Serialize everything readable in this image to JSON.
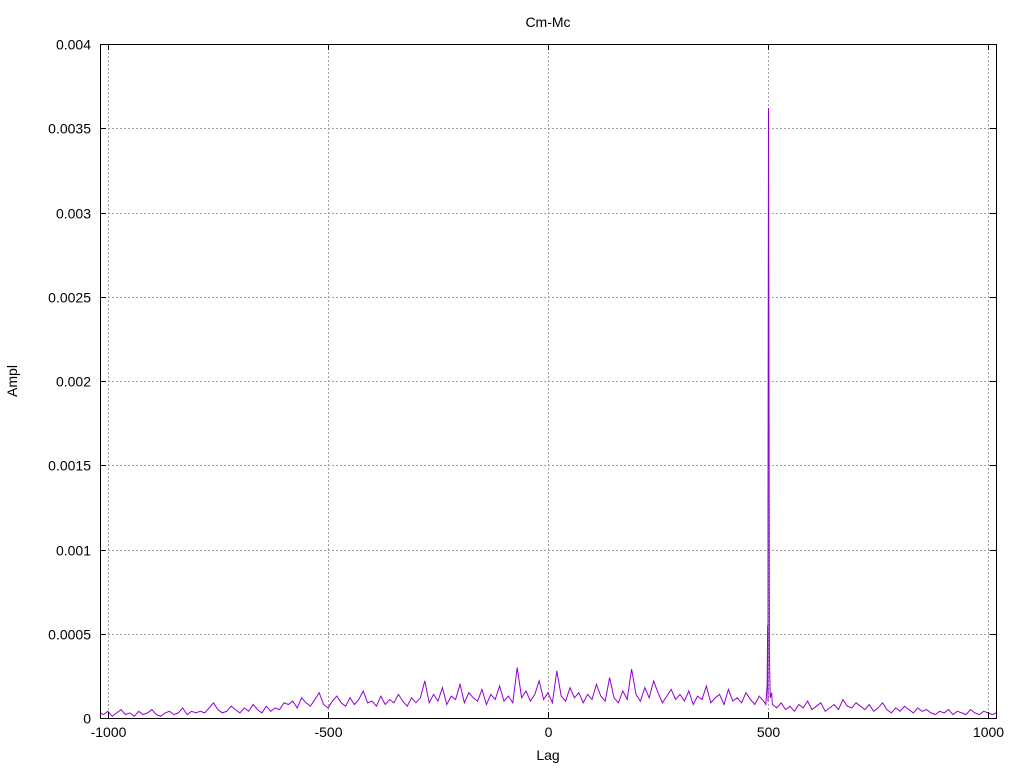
{
  "chart_data": {
    "type": "line",
    "title": "Cm-Mc",
    "xlabel": "Lag",
    "ylabel": "Ampl",
    "xlim": [
      -1018,
      1018
    ],
    "ylim": [
      0,
      0.004
    ],
    "grid": true,
    "legend": "none",
    "xticks": [
      -1000,
      -500,
      0,
      500,
      1000
    ],
    "xtick_labels": [
      "-1000",
      "-500",
      "0",
      "500",
      "1000"
    ],
    "yticks": [
      0,
      0.0005,
      0.001,
      0.0015,
      0.002,
      0.0025,
      0.003,
      0.0035,
      0.004
    ],
    "ytick_labels": [
      "0",
      "0.0005",
      "0.001",
      "0.0015",
      "0.002",
      "0.0025",
      "0.003",
      "0.0035",
      "0.004"
    ],
    "series": [
      {
        "name": "Cm-Mc",
        "color": "#9400d3",
        "x_start": -1020,
        "x_step": 10,
        "values": [
          3e-05,
          2e-05,
          4e-05,
          1e-05,
          3e-05,
          5e-05,
          2e-05,
          3e-05,
          1e-05,
          4e-05,
          2e-05,
          3e-05,
          5e-05,
          2e-05,
          1e-05,
          3e-05,
          4e-05,
          2e-05,
          3e-05,
          6e-05,
          2e-05,
          4e-05,
          3e-05,
          4e-05,
          3e-05,
          6e-05,
          9e-05,
          5e-05,
          3e-05,
          4e-05,
          7e-05,
          5e-05,
          3e-05,
          6e-05,
          4e-05,
          8e-05,
          5e-05,
          3e-05,
          7e-05,
          4e-05,
          6e-05,
          5e-05,
          9e-05,
          8e-05,
          0.0001,
          6e-05,
          0.00012,
          9e-05,
          7e-05,
          0.00011,
          0.00015,
          8e-05,
          6e-05,
          0.0001,
          0.00013,
          9e-05,
          7e-05,
          0.00012,
          8e-05,
          0.00011,
          0.00016,
          9e-05,
          0.0001,
          7e-05,
          0.00013,
          8e-05,
          0.00011,
          9e-05,
          0.00014,
          0.0001,
          7e-05,
          0.00012,
          9e-05,
          0.00012,
          0.00022,
          9e-05,
          0.00014,
          0.0001,
          0.00018,
          8e-05,
          0.00013,
          0.00011,
          0.0002,
          9e-05,
          0.00015,
          0.00012,
          0.0001,
          0.00017,
          8e-05,
          0.00014,
          0.00011,
          0.00019,
          0.0001,
          0.00013,
          9e-05,
          0.0003,
          0.00012,
          0.00016,
          0.0001,
          0.00014,
          0.00022,
          0.00011,
          0.00015,
          9e-05,
          0.00028,
          0.00013,
          0.0001,
          0.00018,
          0.00012,
          0.00015,
          9e-05,
          0.00014,
          0.00011,
          0.0002,
          0.00013,
          0.0001,
          0.00024,
          0.00012,
          9e-05,
          0.00016,
          0.00011,
          0.00029,
          0.00014,
          0.0001,
          0.00018,
          0.00012,
          0.00022,
          0.00015,
          9e-05,
          0.00013,
          0.00017,
          0.00011,
          0.00014,
          0.0001,
          0.00016,
          8e-05,
          0.00013,
          0.00011,
          0.00019,
          9e-05,
          0.00012,
          0.00014,
          8e-05,
          0.00017,
          0.0001,
          0.00012,
          9e-05,
          0.00015,
          0.00011,
          8e-05,
          0.00013,
          0.0001,
          0.0001,
          8e-05,
          6e-05,
          9e-05,
          5e-05,
          7e-05,
          4e-05,
          8e-05,
          6e-05,
          0.0001,
          5e-05,
          7e-05,
          9e-05,
          4e-05,
          6e-05,
          8e-05,
          5e-05,
          0.00011,
          7e-05,
          6e-05,
          9e-05,
          7e-05,
          5e-05,
          8e-05,
          4e-05,
          6e-05,
          9e-05,
          5e-05,
          3e-05,
          6e-05,
          4e-05,
          7e-05,
          5e-05,
          3e-05,
          6e-05,
          4e-05,
          5e-05,
          3e-05,
          2e-05,
          4e-05,
          3e-05,
          5e-05,
          2e-05,
          4e-05,
          3e-05,
          2e-05,
          5e-05,
          3e-05,
          2e-05,
          4e-05,
          3e-05,
          2e-05,
          3e-05
        ],
        "peak_points": [
          [
            495,
            8e-05
          ],
          [
            498,
            0.0002
          ],
          [
            499,
            0.00055
          ],
          [
            500,
            0.00122
          ],
          [
            501,
            0.00362
          ],
          [
            502,
            0.0024
          ],
          [
            503,
            0.00039
          ],
          [
            505,
            0.00012
          ],
          [
            508,
            0.00015
          ]
        ]
      }
    ]
  }
}
